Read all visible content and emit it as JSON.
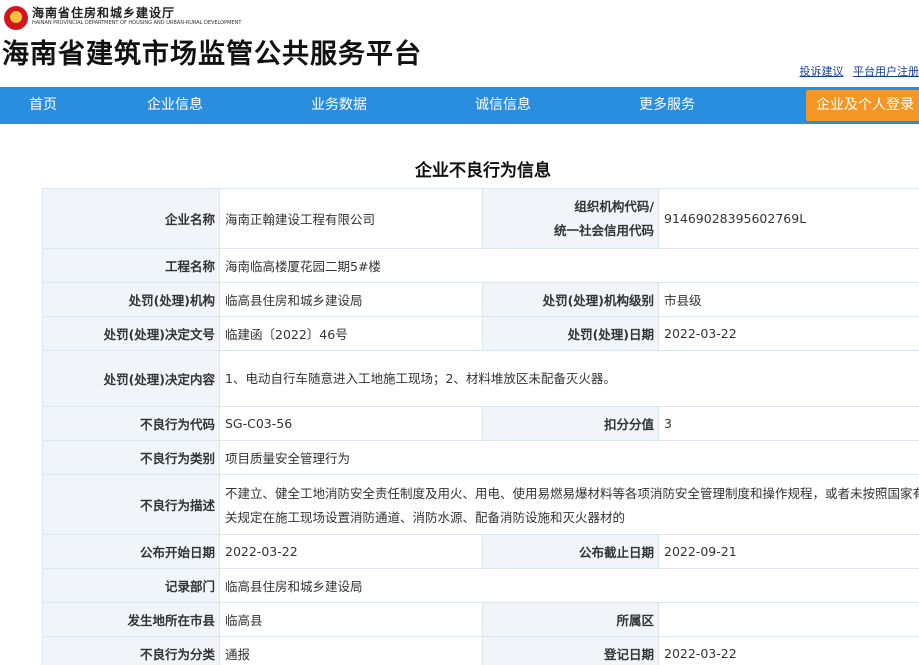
{
  "header": {
    "dept_cn": "海南省住房和城乡建设厅",
    "dept_en": "HAINAN PROVINCIAL DEPARTMENT OF HOUSING AND URBAN-RURAL DEVELOPMENT",
    "site_title": "海南省建筑市场监管公共服务平台",
    "links": [
      "投诉建议",
      "平台用户注册"
    ]
  },
  "nav": {
    "items": [
      "首页",
      "企业信息",
      "业务数据",
      "诚信信息",
      "更多服务"
    ],
    "login": "企业及个人登录"
  },
  "page": {
    "heading": "企业不良行为信息"
  },
  "record": {
    "company_label": "企业名称",
    "company": "海南正翰建设工程有限公司",
    "org_code_label_1": "组织机构代码/",
    "org_code_label_2": "统一社会信用代码",
    "org_code": "91469028395602769L",
    "project_label": "工程名称",
    "project": "海南临高楼厦花园二期5#楼",
    "authority_label": "处罚(处理)机构",
    "authority": "临高县住房和城乡建设局",
    "authority_level_label": "处罚(处理)机构级别",
    "authority_level": "市县级",
    "decision_no_label": "处罚(处理)决定文号",
    "decision_no": "临建函〔2022〕46号",
    "decision_date_label": "处罚(处理)日期",
    "decision_date": "2022-03-22",
    "decision_content_label": "处罚(处理)决定内容",
    "decision_content": "1、电动自行车随意进入工地施工现场；2、材料堆放区未配备灭火器。",
    "behavior_code_label": "不良行为代码",
    "behavior_code": "SG-C03-56",
    "points_label": "扣分分值",
    "points": "3",
    "behavior_type_label": "不良行为类别",
    "behavior_type": "项目质量安全管理行为",
    "behavior_desc_label": "不良行为描述",
    "behavior_desc": "不建立、健全工地消防安全责任制度及用火、用电、使用易燃易爆材料等各项消防安全管理制度和操作规程，或者未按照国家有关规定在施工现场设置消防通道、消防水源、配备消防设施和灭火器材的",
    "publish_start_label": "公布开始日期",
    "publish_start": "2022-03-22",
    "publish_end_label": "公布截止日期",
    "publish_end": "2022-09-21",
    "record_dept_label": "记录部门",
    "record_dept": "临高县住房和城乡建设局",
    "city_label": "发生地所在市县",
    "city": "临高县",
    "district_label": "所属区",
    "district": "",
    "category_label": "不良行为分类",
    "category": "通报",
    "register_date_label": "登记日期",
    "register_date": "2022-03-22"
  }
}
